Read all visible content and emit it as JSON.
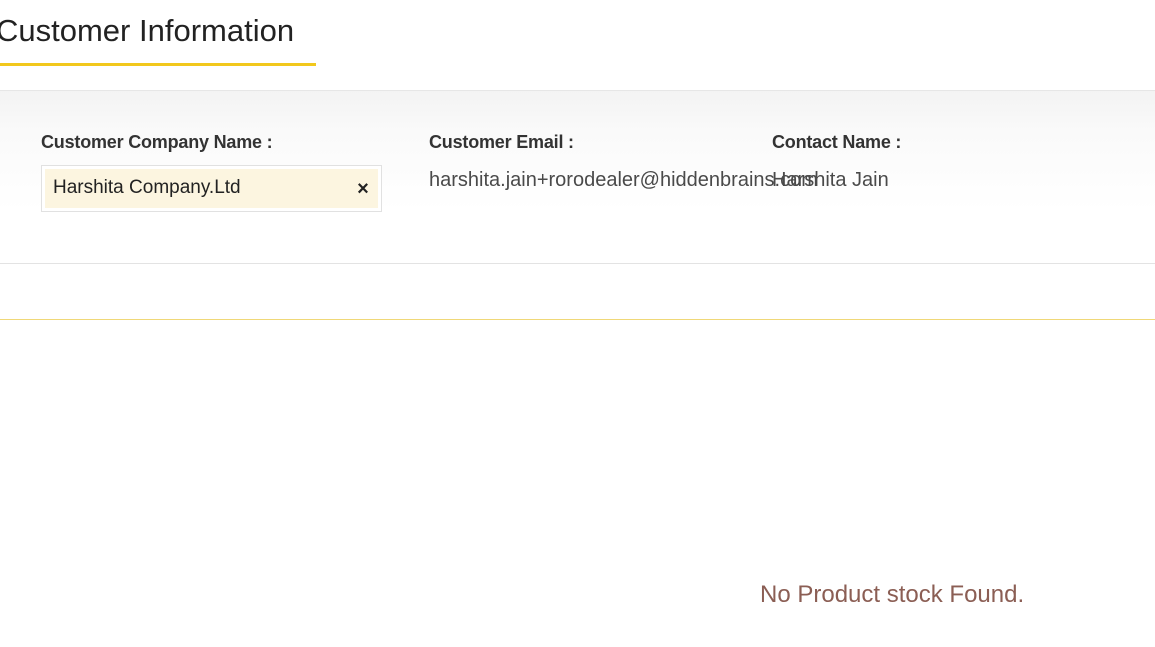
{
  "header": {
    "title": "Customer Information"
  },
  "customer": {
    "company_label": "Customer Company Name :",
    "company_value": "Harshita Company.Ltd",
    "clear_glyph": "×",
    "email_label": "Customer Email :",
    "email_value": "harshita.jain+rorodealer@hiddenbrains.com",
    "contact_label": "Contact Name :",
    "contact_value": "Harshita Jain"
  },
  "products": {
    "empty_message": "No Product stock Found."
  },
  "colors": {
    "accent": "#f2c81c",
    "chip_bg": "#fcf5e0",
    "empty_text": "#8b5e54"
  },
  "icons": {
    "clear": "close-icon"
  }
}
